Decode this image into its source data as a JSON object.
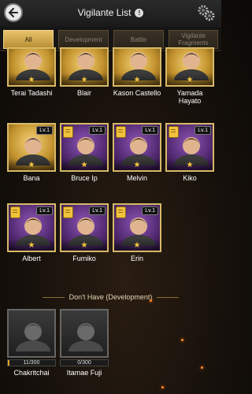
{
  "header": {
    "title": "Vigilante List",
    "info_glyph": "!"
  },
  "tabs": [
    {
      "label": "All",
      "active": true
    },
    {
      "label": "Development",
      "active": false
    },
    {
      "label": "Battle",
      "active": false
    },
    {
      "label": "Vigilante Fragments",
      "active": false
    }
  ],
  "owned": [
    {
      "name": "Terai Tadashi",
      "frame": "gold",
      "stars": 1,
      "level": null,
      "fragment_icon": false
    },
    {
      "name": "Blair",
      "frame": "gold",
      "stars": 1,
      "level": null,
      "fragment_icon": false
    },
    {
      "name": "Kason Castello",
      "frame": "gold",
      "stars": 1,
      "level": null,
      "fragment_icon": false
    },
    {
      "name": "Yamada Hayato",
      "frame": "gold",
      "stars": 1,
      "level": null,
      "fragment_icon": false
    },
    {
      "name": "Bana",
      "frame": "gold",
      "stars": 1,
      "level": "Lv.1",
      "fragment_icon": false
    },
    {
      "name": "Bruce Ip",
      "frame": "purple",
      "stars": 1,
      "level": "Lv.1",
      "fragment_icon": true
    },
    {
      "name": "Melvin",
      "frame": "purple",
      "stars": 1,
      "level": "Lv.1",
      "fragment_icon": true
    },
    {
      "name": "Kiko",
      "frame": "purple",
      "stars": 1,
      "level": "Lv.1",
      "fragment_icon": true
    },
    {
      "name": "Albert",
      "frame": "purple",
      "stars": 1,
      "level": "Lv.1",
      "fragment_icon": true
    },
    {
      "name": "Fumiko",
      "frame": "purple",
      "stars": 1,
      "level": "Lv.1",
      "fragment_icon": true
    },
    {
      "name": "Erin",
      "frame": "purple",
      "stars": 1,
      "level": "Lv.1",
      "fragment_icon": true
    }
  ],
  "not_owned_section": {
    "title": "Don't Have (Development)"
  },
  "not_owned": [
    {
      "name": "Chakritchai",
      "progress": "11/300",
      "progress_value": 11,
      "progress_max": 300
    },
    {
      "name": "Itamae Fuji",
      "progress": "0/300",
      "progress_value": 0,
      "progress_max": 300
    }
  ],
  "colors": {
    "accent_gold": "#e7c36c",
    "star": "#f7c841",
    "purple_frame": "#532a73"
  },
  "icons": [
    "back-arrow-icon",
    "info-icon",
    "gear-icon",
    "star-icon",
    "fragment-document-icon"
  ]
}
